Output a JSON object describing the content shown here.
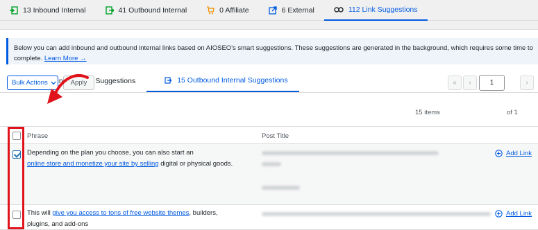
{
  "top_tabs": [
    {
      "label": "13 Inbound Internal",
      "icon": "inbound-arrow-icon"
    },
    {
      "label": "41 Outbound Internal",
      "icon": "outbound-arrow-icon"
    },
    {
      "label": "0 Affiliate",
      "icon": "cart-icon"
    },
    {
      "label": "6 External",
      "icon": "external-link-icon"
    },
    {
      "label": "112 Link Suggestions",
      "icon": "link-icon",
      "active": true
    }
  ],
  "notice": {
    "text": "Below you can add inbound and outbound internal links based on AIOSEO's smart suggestions. These suggestions are generated in the background, which requires some time to",
    "text2": "complete.",
    "link": "Learn More →"
  },
  "sub_tabs": [
    {
      "label": "97 Inbound Internal Suggestions"
    },
    {
      "label": "15 Outbound Internal Suggestions",
      "active": true
    }
  ],
  "toolbar": {
    "bulk_actions_label": "Bulk Actions",
    "apply_label": "Apply"
  },
  "pagination": {
    "items": "15 items",
    "first": "«",
    "prev": "‹",
    "current_page": "1",
    "of": "of 1",
    "next": "›"
  },
  "table": {
    "columns": [
      "Phrase",
      "Post Title"
    ],
    "rows": [
      {
        "checked": true,
        "phrase_before": "Depending on the plan you choose, you can also start an",
        "phrase_link": "online store and monetize your site by selling",
        "phrase_after": " digital or physical goods.",
        "action": "Add Link"
      },
      {
        "checked": false,
        "phrase_before": "This will ",
        "phrase_link": "give you access to tons of free website themes",
        "phrase_after": ", builders,",
        "phrase_line2": "plugins, and add-ons",
        "action": "Add Link"
      }
    ]
  },
  "colors": {
    "accent": "#005ae0",
    "annotation_red": "#e0121a"
  }
}
